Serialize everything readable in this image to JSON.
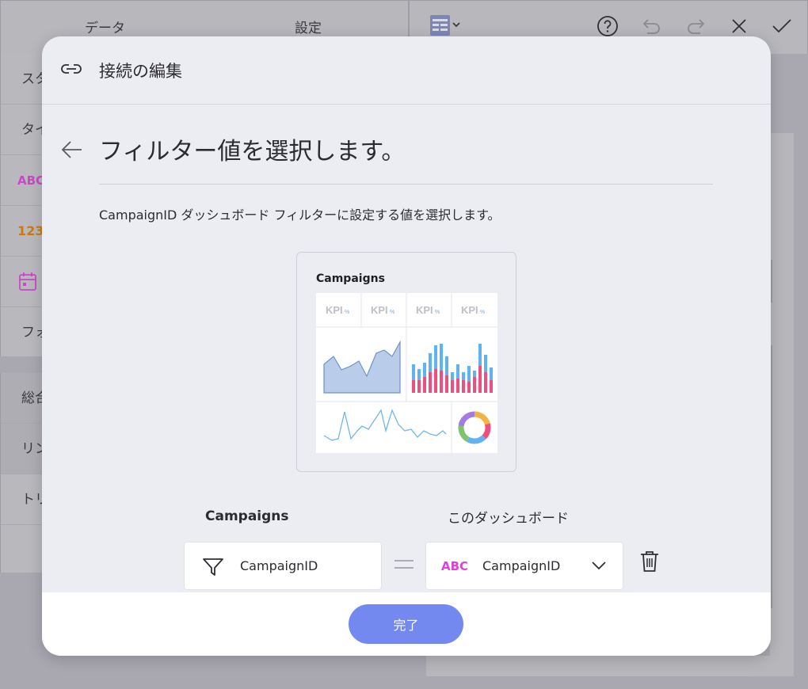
{
  "background": {
    "tabs": {
      "data": "データ",
      "settings": "設定"
    },
    "left_rows": [
      "スタ",
      "タイ",
      "ABC",
      "123",
      "",
      "フォ",
      "総合",
      "リン",
      "トリ"
    ]
  },
  "modal": {
    "title": "接続の編集",
    "step_title": "フィルター値を選択します。",
    "description": "CampaignID ダッシュボード フィルターに設定する値を選択します。",
    "thumbnail": {
      "title": "Campaigns",
      "kpi_labels": [
        "KPI",
        "KPI",
        "KPI",
        "KPI"
      ],
      "kpi_suffix": "%"
    },
    "mapping": {
      "left_label": "Campaigns",
      "right_label": "このダッシュボード",
      "left_field": "CampaignID",
      "right_field": "CampaignID",
      "right_type_badge": "ABC"
    },
    "footer": {
      "done_label": "完了"
    }
  },
  "colors": {
    "accent": "#7389f0",
    "abc_badge": "#e040e0",
    "chart_area": "#b9cdea",
    "chart_bar_blue": "#5fb3f0",
    "chart_bar_pink": "#ef4f7d"
  },
  "icons": [
    "link-icon",
    "back-arrow-icon",
    "filter-icon",
    "chevron-down-icon",
    "trash-icon",
    "help-icon",
    "undo-icon",
    "redo-icon",
    "close-icon",
    "check-icon",
    "grid-icon",
    "calendar-icon"
  ]
}
